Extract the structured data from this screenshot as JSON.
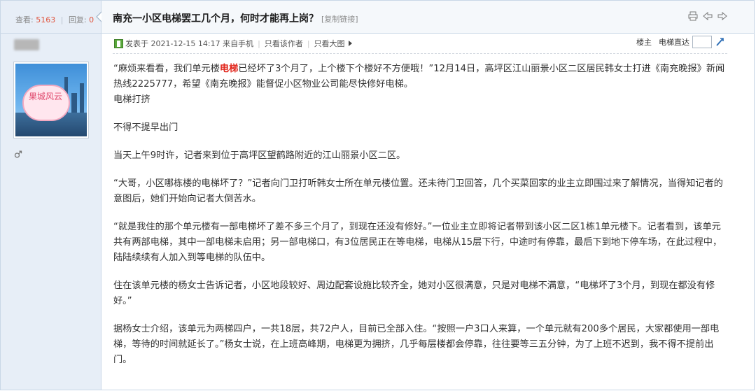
{
  "stats": {
    "views_label": "查看:",
    "views": "5163",
    "replies_label": "回复:",
    "replies": "0"
  },
  "thread": {
    "title": "南充一小区电梯罢工几个月，何时才能再上岗？",
    "copy_link": "[复制链接]"
  },
  "author": {
    "avatar_text": "果城风云"
  },
  "meta": {
    "posted": "发表于 2021-12-15 14:17 来自手机",
    "only_author": "只看该作者",
    "only_images": "只看大图",
    "floor_label": "楼主",
    "jump_label": "电梯直达"
  },
  "content": {
    "p1_pre": "“麻烦来看看，我们单元楼",
    "p1_kw": "电梯",
    "p1_post": "已经坏了3个月了，上个楼下个楼好不方便哦！”12月14日，高坪区江山丽景小区二区居民韩女士打进《南充晚报》新闻热线2225777，希望《南充晚报》能督促小区物业公司能尽快修好电梯。",
    "p2": "电梯打挤",
    "p3": "不得不提早出门",
    "p4": "当天上午9时许，记者来到位于高坪区望鹤路附近的江山丽景小区二区。",
    "p5": "“大哥，小区哪栋楼的电梯坏了？”记者向门卫打听韩女士所在单元楼位置。还未待门卫回答，几个买菜回家的业主立即围过来了解情况，当得知记者的意图后，她们开始向记者大倒苦水。",
    "p6": "“就是我住的那个单元楼有一部电梯坏了差不多三个月了，到现在还没有修好。”一位业主立即将记者带到该小区二区1栋1单元楼下。记者看到，该单元共有两部电梯，其中一部电梯未启用；另一部电梯口，有3位居民正在等电梯，电梯从15层下行，中途时有停靠，最后下到地下停车场，在此过程中，陆陆续续有人加入到等电梯的队伍中。",
    "p7": "住在该单元楼的杨女士告诉记者，小区地段较好、周边配套设施比较齐全，她对小区很满意，只是对电梯不满意，“电梯坏了3个月，到现在都没有修好。”",
    "p8": "据杨女士介绍，该单元为两梯四户，一共18层，共72户人，目前已全部入住。“按照一户3口人来算，一个单元就有200多个居民，大家都使用一部电梯，等待的时间就延长了。”杨女士说，在上班高峰期，电梯更为拥挤，几乎每层楼都会停靠，往往要等三五分钟，为了上班不迟到，我不得不提前出门。"
  },
  "colors": {
    "accent_red": "#e1251b",
    "stats_num": "#e0543d",
    "sidebar_bg": "#e7eef7"
  },
  "icons": [
    "chevron-left-icon",
    "print-icon",
    "prev-thread-icon",
    "next-thread-icon",
    "mobile-post-icon",
    "gender-icon",
    "jump-go-icon"
  ]
}
